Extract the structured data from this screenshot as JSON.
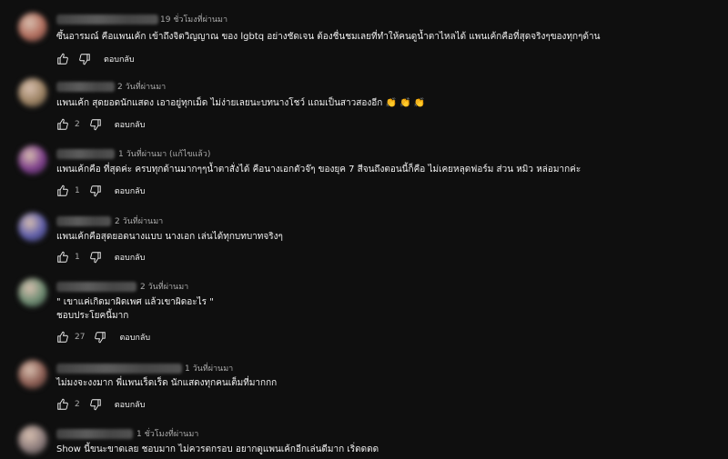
{
  "reply_label": "ตอบกลับ",
  "comments": [
    {
      "time": "19 ชั่วโมงที่ผ่านมา",
      "lines": [
        "ซึ้นอารมณ์ คือแพนเค้ก เข้าถึงจิตวิญญาณ ของ lgbtq อย่างชัดเจน ต้องชื่นชมเลยที่ทำให้คนดูน้ำตาไหลได้ แพนเค้กคือที่สุดจริงๆของทุกๆด้าน"
      ],
      "likes": "",
      "avatar_color": "#b06a5a"
    },
    {
      "time": "2 วันที่ผ่านมา",
      "lines": [
        "แพนเค้ก สุดยอดนักแสดง เอาอยู่ทุกเม็ด ไม่ง่ายเลยนะบทนางโชว์ แถมเป็นสาวสองอีก 👏 👏 👏"
      ],
      "likes": "2",
      "avatar_color": "#9a8060"
    },
    {
      "time": "1 วันที่ผ่านมา (แก้ไขแล้ว)",
      "lines": [
        "แพนเค้กคือ ที่สุดค่ะ ครบทุกด้านมากๆๆน้ำตาสั่งได้ คือนางเอกตัวจ๊ๆ ของยุค 7 สีจนถึงตอนนี้ก็คือ ไม่เคยหลุดฟอร์ม  ส่วน หมิว หล่อมากค่ะ"
      ],
      "likes": "1",
      "avatar_color": "#7a3a8a"
    },
    {
      "time": "2 วันที่ผ่านมา",
      "lines": [
        "แพนเค้กคือสุดยอดนางแบบ นางเอก เล่นได้ทุกบทบาทจริงๆ"
      ],
      "likes": "1",
      "avatar_color": "#5a5aaa"
    },
    {
      "time": "2 วันที่ผ่านมา",
      "lines": [
        "\" เขาแค่เกิดมาผิดเพศ แล้วเขาผิดอะไร \"",
        "ชอบประโยคนี้มาก"
      ],
      "likes": "27",
      "avatar_color": "#6a8a70"
    },
    {
      "time": "1 วันที่ผ่านมา",
      "lines": [
        "ไม่มงจะงงมาก พี่แพนเร็ดเร็ด นักแสดงทุกคนเต็มที่มากกก"
      ],
      "likes": "2",
      "avatar_color": "#8a5a50"
    },
    {
      "time": "1 ชั่วโมงที่ผ่านมา",
      "lines": [
        "Show นี้ขนะขาดเลย ชอบมาก ไม่ควรตกรอบ อยากดูแพนเค้กอีกเล่นดีมาก เริ่ดดดด"
      ],
      "likes": "",
      "avatar_color": "#8a7a7a"
    }
  ]
}
